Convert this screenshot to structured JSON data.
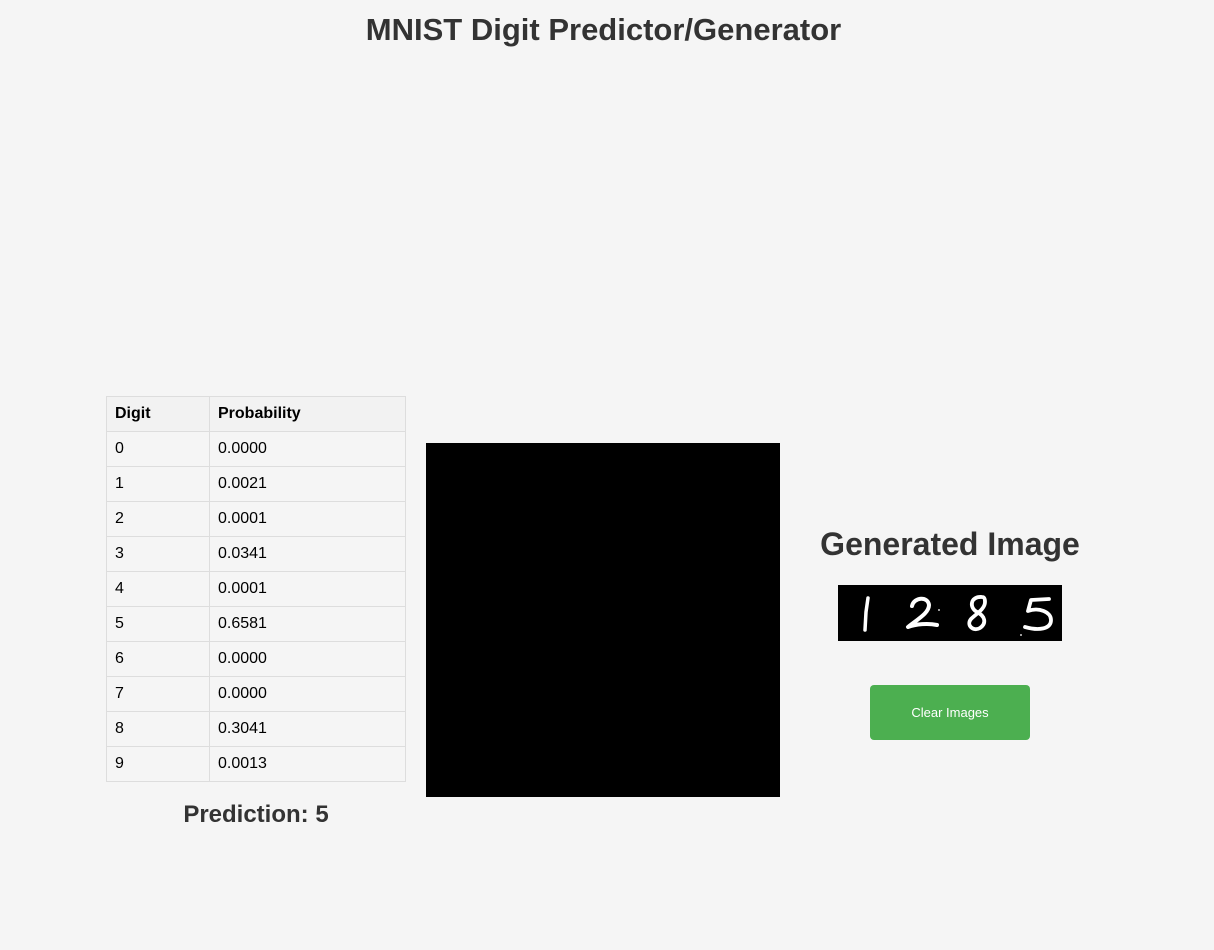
{
  "page": {
    "title": "MNIST Digit Predictor/Generator"
  },
  "probability_table": {
    "headers": [
      "Digit",
      "Probability"
    ],
    "rows": [
      {
        "digit": "0",
        "probability": "0.0000"
      },
      {
        "digit": "1",
        "probability": "0.0021"
      },
      {
        "digit": "2",
        "probability": "0.0001"
      },
      {
        "digit": "3",
        "probability": "0.0341"
      },
      {
        "digit": "4",
        "probability": "0.0001"
      },
      {
        "digit": "5",
        "probability": "0.6581"
      },
      {
        "digit": "6",
        "probability": "0.0000"
      },
      {
        "digit": "7",
        "probability": "0.0000"
      },
      {
        "digit": "8",
        "probability": "0.3041"
      },
      {
        "digit": "9",
        "probability": "0.0013"
      }
    ]
  },
  "prediction": {
    "text": "Prediction: 5"
  },
  "drawing_canvas": {
    "background_color": "#000000"
  },
  "generated": {
    "heading": "Generated Image",
    "digits": [
      "1",
      "2",
      "8",
      "5"
    ]
  },
  "controls": {
    "clear_label": "Clear Images",
    "clear_color": "#4caf50"
  }
}
